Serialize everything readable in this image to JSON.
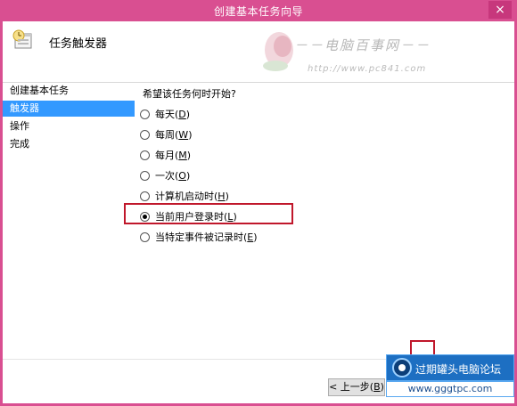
{
  "window": {
    "title": "创建基本任务向导",
    "close_glyph": "×"
  },
  "header": {
    "title": "任务触发器",
    "icon": "task-clock-icon"
  },
  "watermark": {
    "text": "－－电脑百事网－－",
    "url": "http://www.pc841.com"
  },
  "sidebar": {
    "items": [
      {
        "label": "创建基本任务",
        "active": false
      },
      {
        "label": "触发器",
        "active": true
      },
      {
        "label": "操作",
        "active": false
      },
      {
        "label": "完成",
        "active": false
      }
    ]
  },
  "main": {
    "question": "希望该任务何时开始?",
    "options": [
      {
        "label": "每天(",
        "key": "D",
        "tail": ")",
        "checked": false
      },
      {
        "label": "每周(",
        "key": "W",
        "tail": ")",
        "checked": false
      },
      {
        "label": "每月(",
        "key": "M",
        "tail": ")",
        "checked": false
      },
      {
        "label": "一次(",
        "key": "O",
        "tail": ")",
        "checked": false
      },
      {
        "label": "计算机启动时(",
        "key": "H",
        "tail": ")",
        "checked": false
      },
      {
        "label": "当前用户登录时(",
        "key": "L",
        "tail": ")",
        "checked": true
      },
      {
        "label": "当特定事件被记录时(",
        "key": "E",
        "tail": ")",
        "checked": false
      }
    ]
  },
  "footer": {
    "back_label": "< 上一步(",
    "back_key": "B",
    "back_tail": ")"
  },
  "badge": {
    "name": "过期罐头电脑论坛",
    "url": "www.gggtpc.com"
  },
  "colors": {
    "titlebar": "#d94f91",
    "selection": "#3399ff",
    "highlight": "#c0172b"
  }
}
